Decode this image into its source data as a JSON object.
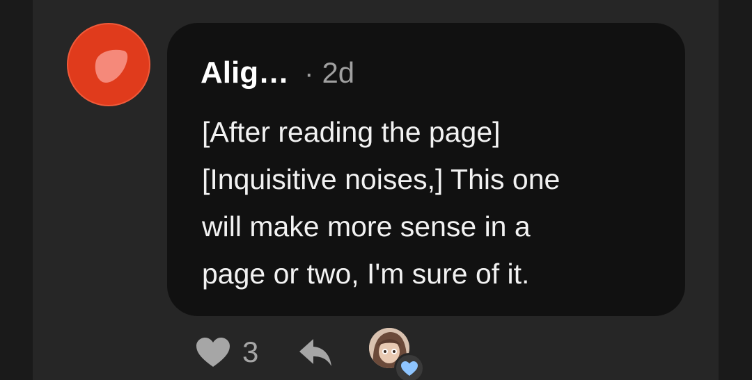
{
  "comment": {
    "author": "Alig…",
    "separator": "·",
    "age": "2d",
    "text_lines": [
      "[After reading the page]",
      "[Inquisitive noises,] This one",
      "will make more sense in a",
      "page or two, I'm sure of it."
    ]
  },
  "actions": {
    "like_count": "3",
    "like_icon": "heart-icon",
    "reply_icon": "reply-icon",
    "reaction_icon": "blue-heart-icon"
  },
  "colors": {
    "background": "#1a1a1a",
    "column": "#262626",
    "bubble": "#111111",
    "avatar": "#e03b1c",
    "reaction": "#8ec5ff"
  }
}
